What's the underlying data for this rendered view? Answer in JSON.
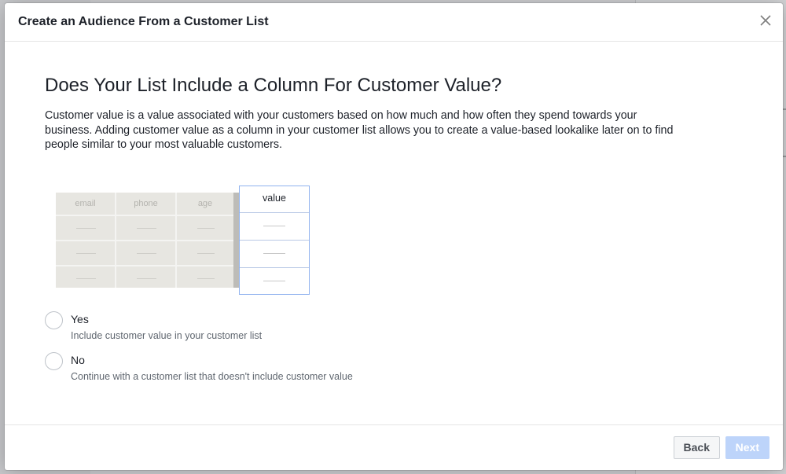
{
  "modal": {
    "title": "Create an Audience From a Customer List",
    "heading": "Does Your List Include a Column For Customer Value?",
    "description": "Customer value is a value associated with your customers based on how much and how often they spend towards your business. Adding customer value as a column in your customer list allows you to create a value-based lookalike later on to find people similar to your most valuable customers."
  },
  "illustration": {
    "columns": [
      "email",
      "phone",
      "age"
    ],
    "highlight_column": "value"
  },
  "options": [
    {
      "label": "Yes",
      "sublabel": "Include customer value in your customer list",
      "selected": false
    },
    {
      "label": "No",
      "sublabel": "Continue with a customer list that doesn't include customer value",
      "selected": false
    }
  ],
  "footer": {
    "back_label": "Back",
    "next_label": "Next"
  },
  "icons": {
    "close": "close-icon"
  },
  "colors": {
    "next_disabled_bg": "#bdd4fa",
    "highlight_border": "#8fb2ef"
  }
}
